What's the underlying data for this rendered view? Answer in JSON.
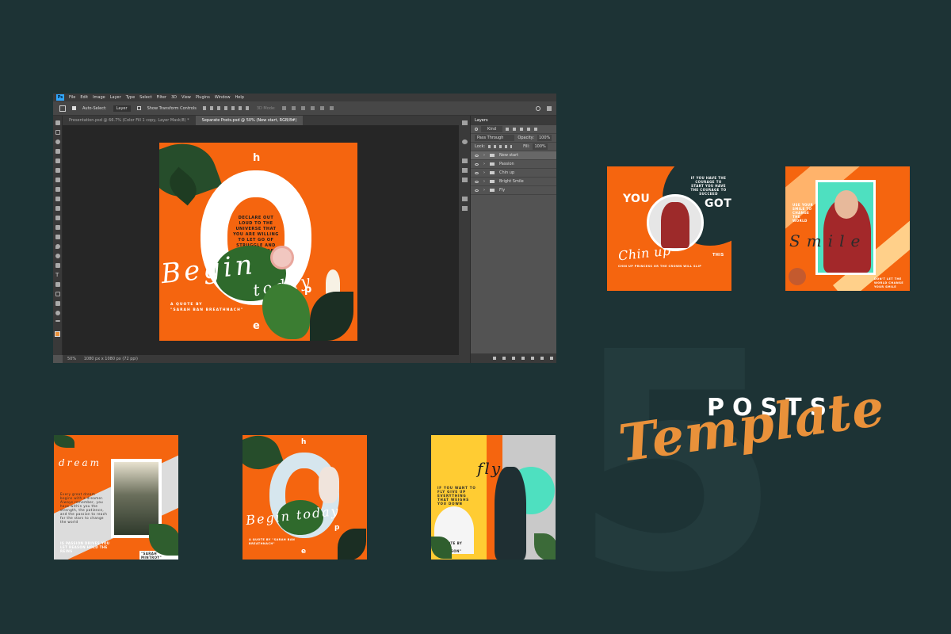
{
  "hero": {
    "number": "5",
    "word1": "POSTS",
    "word2": "Template"
  },
  "photoshop": {
    "app_logo": "Ps",
    "menu": [
      "File",
      "Edit",
      "Image",
      "Layer",
      "Type",
      "Select",
      "Filter",
      "3D",
      "View",
      "Plugins",
      "Window",
      "Help"
    ],
    "options": {
      "auto_select": "Auto-Select:",
      "auto_select_value": "Layer",
      "transform_controls": "Show Transform Controls",
      "mode_3d": "3D Mode:"
    },
    "tabs": [
      {
        "label": "Presentation.psd @ 66.7% (Color Fill 1 copy, Layer Mask/8) *"
      },
      {
        "label": "Separate Posts.psd @ 50% (New start, RGB/8#)"
      }
    ],
    "status": {
      "zoom": "50%",
      "dims": "1080 px x 1080 px (72 ppi)"
    },
    "layers_panel": {
      "title": "Layers",
      "filter": "Kind",
      "blend": "Pass Through",
      "opacity_label": "Opacity:",
      "opacity": "100%",
      "lock_label": "Lock:",
      "fill_label": "Fill:",
      "fill": "100%",
      "layers": [
        "New start",
        "Passion",
        "Chin up",
        "Bright Smile",
        "Fly"
      ],
      "selected_layer": "New start"
    },
    "design": {
      "letter_h": "h",
      "letter_p": "p",
      "letter_e": "e",
      "quote": "DECLARE OUT LOUD TO THE UNIVERSE THAT YOU ARE WILLING TO LET GO OF STRUGGLE AND EAGER TO LEARN THROUGH JOY",
      "script1": "Begin",
      "script2": "today",
      "byline1": "A QUOTE BY",
      "byline2": "\"SARAH BAN BREATHNACH\""
    }
  },
  "thumbnails": {
    "t1": {
      "letters_left": "YOU",
      "letters_right": "GOT",
      "script": "Chin up",
      "tag": "THIS",
      "quote": "IF YOU HAVE THE COURAGE TO START YOU HAVE THE COURAGE TO SUCCEED",
      "bottom": "CHIN UP PRINCESS OR THE CROWN WILL SLIP"
    },
    "t2": {
      "quote": "USE YOUR SMILE TO CHANGE THE WORLD",
      "script": "Smile",
      "bottom": "DON'T LET THE WORLD CHANGE YOUR SMILE"
    },
    "t3": {
      "script": "dream",
      "quote": "Every great dream begins with a dreamer. Always remember, you have within you the strength, the patience, and the passion to reach for the stars to change the world",
      "bottom": "IS PASSION DRIVES YOU LET REASON HOLD THE REINS",
      "author": "\"SARAH MINTROY\""
    },
    "t4": {
      "letter_h": "h",
      "letter_p": "p",
      "letter_e": "e",
      "script": "Begin today",
      "byline": "A QUOTE BY \"SARAH BAN BREATHNACH\""
    },
    "t5": {
      "script": "fly",
      "quote": "IF YOU WANT TO FLY GIVE UP EVERYTHING THAT WEIGHS YOU DOWN",
      "byline": "A QUOTE BY \"TONI MORRISON\""
    }
  },
  "colors": {
    "bg": "#1d3335",
    "orange": "#f5650f",
    "accent": "#e9913a"
  }
}
